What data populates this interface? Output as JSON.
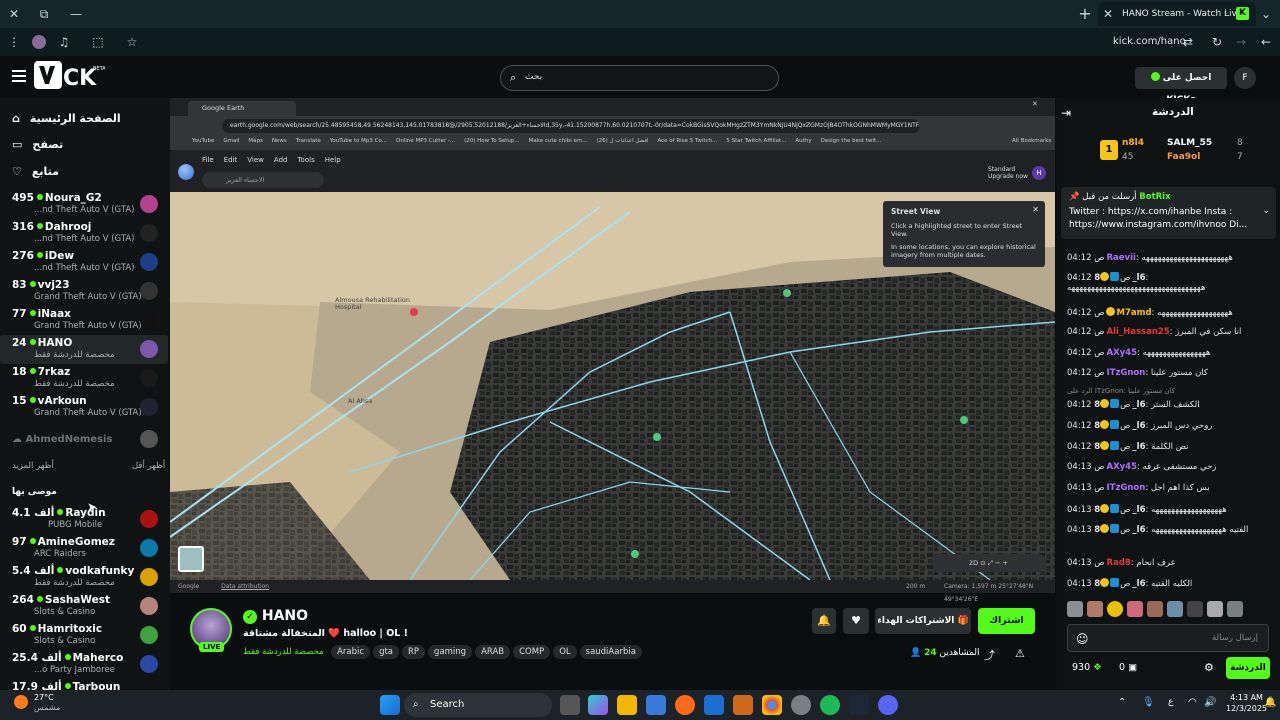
{
  "browser": {
    "tab_title": "HANO Stream - Watch Live",
    "url": "kick.com/hano",
    "new_tab": "+",
    "ext_icon_label": "K"
  },
  "header": {
    "search_placeholder": "بحث",
    "get_kicks": "احصل على KICKs",
    "avatar_letter": "F"
  },
  "sidebar": {
    "nav": [
      {
        "label": "الصفحة الرئيسية",
        "icon": "home-icon"
      },
      {
        "label": "تصفح",
        "icon": "browse-icon"
      },
      {
        "label": "متابع",
        "icon": "heart-icon"
      }
    ],
    "channels": [
      {
        "count": "495",
        "name": "Noura_G2",
        "game": "...nd Theft Auto V (GTA)"
      },
      {
        "count": "316",
        "name": "Dahrooj",
        "game": "...nd Theft Auto V (GTA)"
      },
      {
        "count": "276",
        "name": "iDew",
        "game": "...nd Theft Auto V (GTA)"
      },
      {
        "count": "83",
        "name": "vvj23",
        "game": "Grand Theft Auto V (GTA)"
      },
      {
        "count": "77",
        "name": "iNaax",
        "game": "Grand Theft Auto V (GTA)"
      },
      {
        "count": "24",
        "name": "HANO",
        "game": "مخصصة للدردشة فقط"
      },
      {
        "count": "18",
        "name": "7rkaz",
        "game": "مخصصة للدردشة فقط"
      },
      {
        "count": "15",
        "name": "vArkoun",
        "game": "Grand Theft Auto V (GTA)"
      }
    ],
    "offline_name": "AhmedNemesis",
    "show_more": "أظهر المزيد",
    "show_less": "أظهر أقل",
    "recommended_title": "موصى بها",
    "recommended": [
      {
        "count": "4.1 ألف",
        "name": "Raydin",
        "game": "PUBG Mobile"
      },
      {
        "count": "97",
        "name": "AmineGomez",
        "game": "ARC Raiders"
      },
      {
        "count": "5.4 ألف",
        "name": "vodkafunky",
        "game": "مخصصة للدردشة فقط"
      },
      {
        "count": "264",
        "name": "SashaWest",
        "game": "Slots & Casino"
      },
      {
        "count": "60",
        "name": "Hamritoxic",
        "game": "Slots & Casino"
      },
      {
        "count": "25.4 ألف",
        "name": "Maherco",
        "game": "...o Party Jamboree"
      },
      {
        "count": "17.9 ألف",
        "name": "Tarboun",
        "game": ""
      }
    ]
  },
  "video": {
    "ge_tab": "Google Earth",
    "ge_url": "earth.google.com/web/search/25.48595458,49.56248143,145.01783818@/الاحساء+العزيز/2905.52012188d,35y,-41.15200877h,60.0210707t,-0r/data=CokBGisSVQokMHgzZTM3YmNkNjU4NjQxZGMzOjB4OThkOGNhMWMyMGY1NTFI...",
    "bookmarks": [
      "YouTube",
      "Gmail",
      "Maps",
      "News",
      "Translate",
      "YouTube to Mp3 Co...",
      "Online MP3 Cutter -...",
      "(20) How To Setup...",
      "Make cute chibi em...",
      "افضل اعدادات ل (26)",
      "Ace of Rise 5 Twitch...",
      "5 Star Twitch Affiliat...",
      "Authy",
      "Design the best twit...",
      "All Bookmarks"
    ],
    "menu": [
      "File",
      "Edit",
      "View",
      "Add",
      "Tools",
      "Help"
    ],
    "ge_search_placeholder": "الاحساء العزيز",
    "plan": "Standard",
    "upgrade": "Upgrade now",
    "ge_avatar": "H",
    "streetview_title": "Street View",
    "streetview_l1": "Click a highlighted street to enter Street View.",
    "streetview_l2": "In some locations, you can explore historical imagery from multiple dates.",
    "place1": "Almousa Rehabilitation Hospital",
    "place2": "Al Ahsa",
    "status_left": "Google",
    "status_attr": "Data attribution",
    "status_scale": "200 m",
    "status_right": "Camera: 1,597 m  25°27'48\"N 49°34'26\"E",
    "mode2d": "2D"
  },
  "stream": {
    "name": "HANO",
    "title": "المتخفالة مشتاقة ❤️ halloo | OL !",
    "live": "LIVE",
    "category": "مخصصة للدردشة فقط",
    "tags": [
      "Arabic",
      "gta",
      "RP",
      "gaming",
      "ARAB",
      "COMP",
      "OL",
      "saudiAarbia"
    ],
    "subscribe": "اشتراك",
    "gift": "الاشتراكات الهداء",
    "viewers_label": "المشاهدين",
    "viewers": "24"
  },
  "chat": {
    "title": "الدردشة",
    "leaders": [
      {
        "name": "n8l4",
        "count": "45"
      },
      {
        "name": "SALM_55",
        "count": "8"
      },
      {
        "name": "Faa9ol",
        "count": "7"
      }
    ],
    "pinned_by": "BotRix",
    "pinned_label": "أرسلت من قبل",
    "pinned_text": "Twitter : https://x.com/ihanbe Insta : https://www.instagram.com/ihvnoo Di...",
    "messages": [
      {
        "time": "04:12 ص",
        "user": "Raevii",
        "color": "#a970ff",
        "text": "ههههههههههههههههههههههه"
      },
      {
        "time": "04:12 ص",
        "user": "8_l6",
        "color": "#ffffff",
        "text": "ههههههههههههههههههههههههههههههههههه"
      },
      {
        "time": "04:12 ص",
        "user": "M7amd",
        "color": "#ffc107",
        "text": "ههههههههههههههههههه"
      },
      {
        "time": "04:12 ص",
        "user": "Ali_Hassan25",
        "color": "#e53935",
        "text": "انا سكن في المبرز"
      },
      {
        "time": "04:12 ص",
        "user": "AXy45",
        "color": "#a970ff",
        "text": "ههههههههههههههههه"
      },
      {
        "time": "04:12 ص",
        "user": "ITzGnon",
        "color": "#a970ff",
        "text": "كان مستور علينا"
      },
      {
        "time": "04:12 ص",
        "user": "8_l6",
        "color": "#ffffff",
        "text": "الكشف الستر"
      },
      {
        "time": "04:12 ص",
        "user": "8_l6",
        "color": "#ffffff",
        "text": "روحي دس المبرز"
      },
      {
        "time": "04:12 ص",
        "user": "8_l6",
        "color": "#ffffff",
        "text": "نص الكلمة"
      },
      {
        "time": "04:13 ص",
        "user": "AXy45",
        "color": "#a970ff",
        "text": "رحي مستشفى عرقه"
      },
      {
        "time": "04:13 ص",
        "user": "ITzGnon",
        "color": "#a970ff",
        "text": "بس كذا اهم اجل"
      },
      {
        "time": "04:13 ص",
        "user": "8_l6",
        "color": "#ffffff",
        "text": "ههههههههههههههههههه"
      },
      {
        "time": "04:13 ص",
        "user": "8_l6",
        "color": "#ffffff",
        "text": "الفتيه ههههههههههههههههههه"
      },
      {
        "time": "04:13 ص",
        "user": "Rad8",
        "color": "#e53935",
        "text": "عرف انحام"
      },
      {
        "time": "04:13 ص",
        "user": "8_l6",
        "color": "#ffffff",
        "text": "الكليه الفتيه"
      }
    ],
    "reply_hint": "الرد على ITzGnon: كان مستور علينا",
    "input_placeholder": "إرسال رسالة",
    "points": "930",
    "kicks": "0",
    "send": "الدردشة"
  },
  "taskbar": {
    "weather_temp": "27°C",
    "weather_desc": "مشمس",
    "search": "Search",
    "time": "4:13 AM",
    "date": "12/3/2025"
  }
}
